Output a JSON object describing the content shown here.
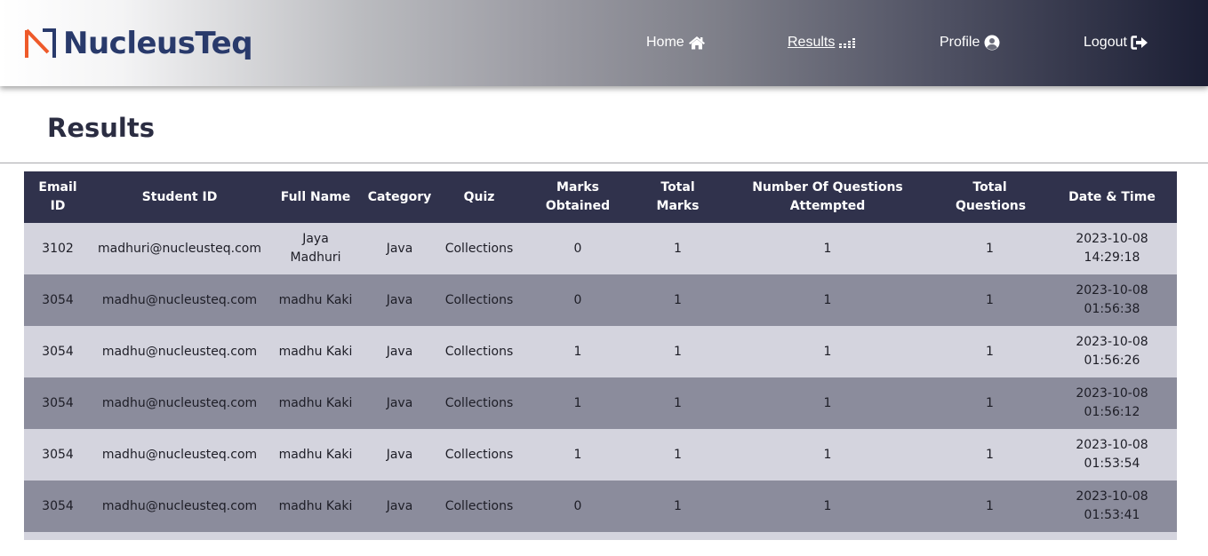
{
  "brand": {
    "name": "NucleusTeq"
  },
  "nav": {
    "home": "Home",
    "results": "Results",
    "profile": "Profile",
    "logout": "Logout"
  },
  "page": {
    "title": "Results"
  },
  "table": {
    "headers": [
      "Email ID",
      "Student ID",
      "Full Name",
      "Category",
      "Quiz",
      "Marks Obtained",
      "Total Marks",
      "Number Of Questions Attempted",
      "Total Questions",
      "Date & Time"
    ],
    "rows": [
      [
        "3102",
        "madhuri@nucleusteq.com",
        "Jaya Madhuri",
        "Java",
        "Collections",
        "0",
        "1",
        "1",
        "1",
        "2023-10-08 14:29:18"
      ],
      [
        "3054",
        "madhu@nucleusteq.com",
        "madhu Kaki",
        "Java",
        "Collections",
        "0",
        "1",
        "1",
        "1",
        "2023-10-08 01:56:38"
      ],
      [
        "3054",
        "madhu@nucleusteq.com",
        "madhu Kaki",
        "Java",
        "Collections",
        "1",
        "1",
        "1",
        "1",
        "2023-10-08 01:56:26"
      ],
      [
        "3054",
        "madhu@nucleusteq.com",
        "madhu Kaki",
        "Java",
        "Collections",
        "1",
        "1",
        "1",
        "1",
        "2023-10-08 01:56:12"
      ],
      [
        "3054",
        "madhu@nucleusteq.com",
        "madhu Kaki",
        "Java",
        "Collections",
        "1",
        "1",
        "1",
        "1",
        "2023-10-08 01:53:54"
      ],
      [
        "3054",
        "madhu@nucleusteq.com",
        "madhu Kaki",
        "Java",
        "Collections",
        "0",
        "1",
        "1",
        "1",
        "2023-10-08 01:53:41"
      ]
    ]
  },
  "colors": {
    "brand_orange": "#ee5a2a",
    "brand_navy": "#293a6b",
    "header_bg": "#30324c",
    "row_light": "#d4d4de",
    "row_dark": "#8b8c9c"
  },
  "icons": {
    "home": "home-icon",
    "results": "chart-bars-icon",
    "profile": "user-circle-icon",
    "logout": "sign-out-icon"
  }
}
